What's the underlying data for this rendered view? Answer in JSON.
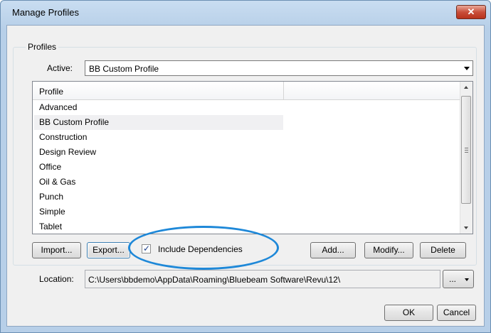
{
  "window": {
    "title": "Manage Profiles",
    "close_glyph": "✕"
  },
  "profiles_group": {
    "label": "Profiles",
    "active_label": "Active:",
    "active_value": "BB Custom Profile"
  },
  "list": {
    "column_header": "Profile",
    "selected_index": 1,
    "items": [
      "Advanced",
      "BB Custom Profile",
      "Construction",
      "Design Review",
      "Office",
      "Oil & Gas",
      "Punch",
      "Simple",
      "Tablet"
    ]
  },
  "actions": {
    "import_label": "Import...",
    "export_label": "Export...",
    "include_dependencies_label": "Include Dependencies",
    "include_dependencies_checked": true,
    "add_label": "Add...",
    "modify_label": "Modify...",
    "delete_label": "Delete"
  },
  "location": {
    "label": "Location:",
    "value": "C:\\Users\\bbdemo\\AppData\\Roaming\\Bluebeam Software\\Revu\\12\\",
    "browse_label": "..."
  },
  "footer": {
    "ok_label": "OK",
    "cancel_label": "Cancel"
  },
  "colors": {
    "annotation_ellipse": "#1e88d8",
    "close_button": "#c94f3a"
  }
}
